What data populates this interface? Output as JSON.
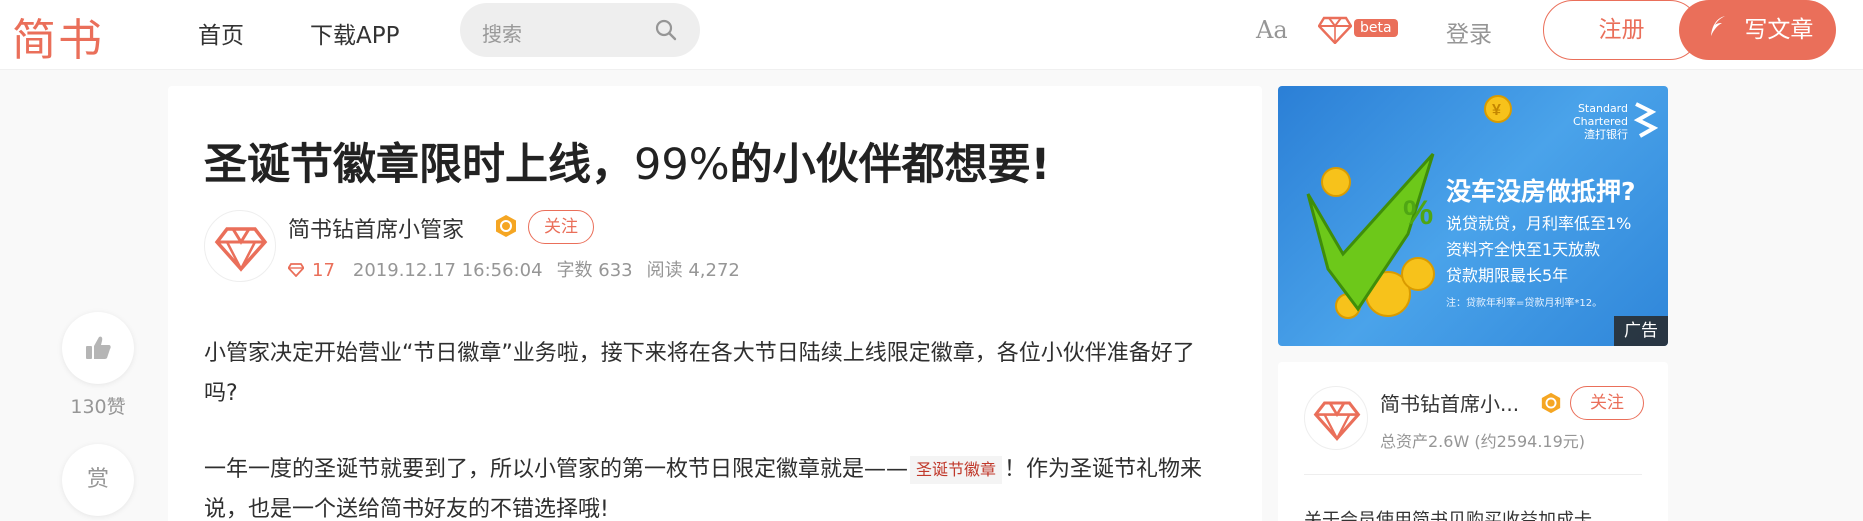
{
  "header": {
    "logo": "简书",
    "nav_home": "首页",
    "nav_app": "下载APP",
    "search_placeholder": "搜索",
    "font_toggle": "Aa",
    "beta": "beta",
    "login": "登录",
    "register": "注册",
    "write": "写文章"
  },
  "article": {
    "title_part1": "圣诞节徽章限时上线，",
    "title_num": "99%",
    "title_part2": "的小伙伴都想要!",
    "author": "简书钻首席小管家",
    "follow": "关注",
    "diamonds": "17",
    "date": "2019.12.17 16:56:04",
    "word_count": "字数 633",
    "reads": "阅读 4,272",
    "p1": "小管家决定开始营业“节日徽章”业务啦，接下来将在各大节日陆续上线限定徽章，各位小伙伴准备好了吗?",
    "p2_before": "一年一度的圣诞节就要到了，所以小管家的第一枚节日限定徽章就是——",
    "p2_badge": "圣诞节徽章",
    "p2_after": "！作为圣诞节礼物来说，也是一个送给简书好友的不错选择哦!"
  },
  "side": {
    "like_count": "130赞",
    "reward": "赏"
  },
  "ad": {
    "brand_line1": "Standard",
    "brand_line2": "Chartered",
    "brand_line3": "渣打银行",
    "headline": "没车没房做抵押?",
    "line1": "说贷就贷，月利率低至1%",
    "line2": "资料齐全快至1天放款",
    "line3": "贷款期限最长5年",
    "note": "注：贷款年利率=贷款月利率*12。",
    "tag": "广告"
  },
  "author_card": {
    "name": "简书钻首席小...",
    "follow": "关注",
    "assets": "总资产2.6W (约2594.19元)",
    "link": "关于会员使用简书贝购买收益加成卡"
  },
  "colors": {
    "brand": "#ea6f5a",
    "muted": "#969696"
  }
}
